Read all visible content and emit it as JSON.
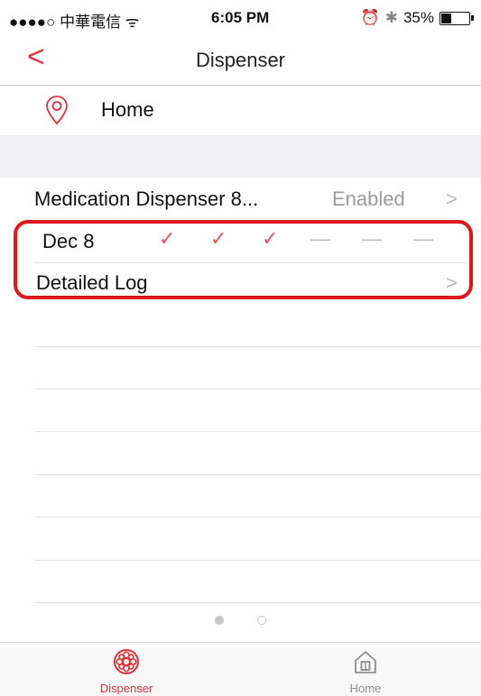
{
  "status_bar": {
    "carrier": "●●●●○ 中華電信 ᯤ",
    "time": "6:05 PM",
    "alarm_glyph": "⏰",
    "bluetooth_glyph": "✱",
    "battery": "35%",
    "battery_level": 0.35
  },
  "nav": {
    "back_glyph": "<",
    "title": "Dispenser"
  },
  "location": {
    "icon": "location-pin-icon",
    "label": "Home"
  },
  "device": {
    "name": "Medication Dispenser 8...",
    "status": "Enabled",
    "chevron": ">"
  },
  "schedule": {
    "date": "Dec  8",
    "doses": [
      "✓",
      "✓",
      "✓",
      "—",
      "—",
      "—"
    ],
    "dose_states": [
      "taken",
      "taken",
      "taken",
      "pending",
      "pending",
      "pending"
    ]
  },
  "log": {
    "label": "Detailed Log",
    "chevron": ">"
  },
  "pager": {
    "pages": 2,
    "current": 1
  },
  "tabs": [
    {
      "label": "Dispenser",
      "icon": "dispenser-icon",
      "active": true
    },
    {
      "label": "Home",
      "icon": "home-icon",
      "active": false
    }
  ],
  "colors": {
    "accent": "#e2333a",
    "highlight": "#e0161e",
    "muted": "#9a9a9a"
  }
}
